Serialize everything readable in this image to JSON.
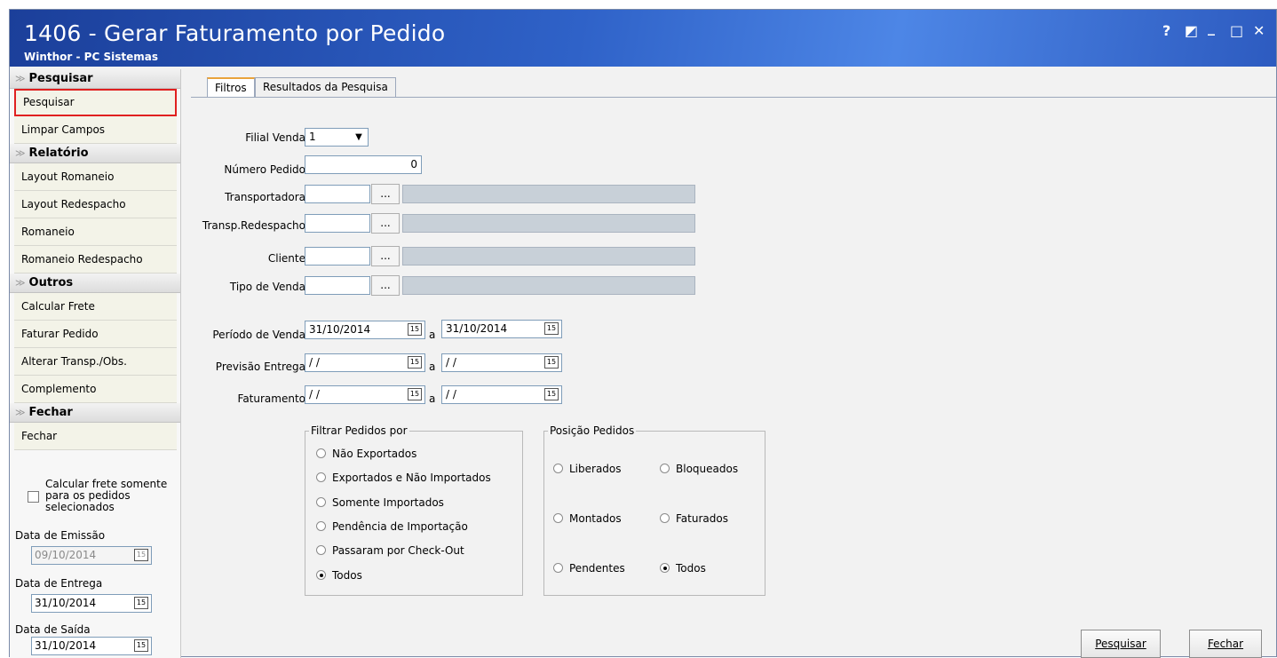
{
  "window": {
    "title": "1406 - Gerar Faturamento por Pedido",
    "subtitle": "Winthor - PC Sistemas",
    "controls": [
      "?",
      "◩",
      "_",
      "□",
      "✕"
    ]
  },
  "sidebar": {
    "sections": [
      {
        "title": "Pesquisar",
        "items": [
          "Pesquisar",
          "Limpar Campos"
        ]
      },
      {
        "title": "Relatório",
        "items": [
          "Layout Romaneio",
          "Layout Redespacho",
          "Romaneio",
          "Romaneio Redespacho"
        ]
      },
      {
        "title": "Outros",
        "items": [
          "Calcular Frete",
          "Faturar Pedido",
          "Alterar Transp./Obs.",
          "Complemento"
        ]
      },
      {
        "title": "Fechar",
        "items": [
          "Fechar"
        ]
      }
    ],
    "checkbox_label": "Calcular frete somente para os pedidos selecionados",
    "data_emissao_label": "Data de Emissão",
    "data_emissao_value": "09/10/2014",
    "data_entrega_label": "Data de Entrega",
    "data_entrega_value": "31/10/2014",
    "data_saida_label": "Data de Saída",
    "data_saida_value": "31/10/2014",
    "calendar_glyph": "15"
  },
  "tabs": {
    "filtros": "Filtros",
    "resultados": "Resultados da Pesquisa"
  },
  "form": {
    "filial_label": "Filial Venda",
    "filial_value": "1",
    "numero_label": "Número Pedido",
    "numero_value": "0",
    "transportadora_label": "Transportadora",
    "redespacho_label": "Transp.Redespacho",
    "cliente_label": "Cliente",
    "tipo_venda_label": "Tipo de Venda",
    "dots": "...",
    "periodo_label": "Período de Venda",
    "periodo_de": "31/10/2014",
    "periodo_ate": "31/10/2014",
    "previsao_label": "Previsão Entrega",
    "previsao_de": "/ /",
    "previsao_ate": "/ /",
    "faturamento_label": "Faturamento",
    "faturamento_de": "/ /",
    "faturamento_ate": "/ /",
    "a": "a"
  },
  "filtrar": {
    "title": "Filtrar Pedidos por",
    "options": [
      "Não Exportados",
      "Exportados e Não Importados",
      "Somente Importados",
      "Pendência de Importação",
      "Passaram por Check-Out",
      "Todos"
    ],
    "selected": "Todos"
  },
  "posicao": {
    "title": "Posição Pedidos",
    "options": [
      "Liberados",
      "Bloqueados",
      "Montados",
      "Faturados",
      "Pendentes",
      "Todos"
    ],
    "selected": "Todos"
  },
  "buttons": {
    "pesquisar": "Pesquisar",
    "fechar": "Fechar"
  }
}
